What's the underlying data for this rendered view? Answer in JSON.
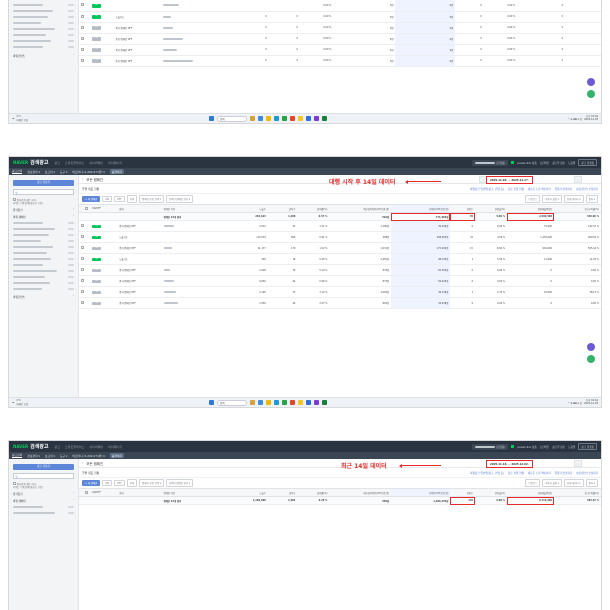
{
  "app": {
    "brand": "NAVER",
    "title": "검색광고",
    "menu": [
      "광고",
      "스마트플레이스",
      "네이버페이",
      "마이페이지"
    ],
    "account": "(운영중)",
    "status": "powerclick 상품",
    "right_items": [
      "조건버튼",
      "광고주 정보",
      "도움말"
    ],
    "right_button": "광고 플랫폼"
  },
  "subnav": {
    "items": [
      "광고관리",
      "정보관리 ▾",
      "보고서 ▾",
      "도구 ▾",
      "비즈머니 (1,202,271원) ▾"
    ],
    "tag": "충전하기"
  },
  "sidebar": {
    "create_button": "광고 만들기",
    "search_icon": "search-icon",
    "check_label": "일치검색 세트 하기,\n키워드 다중검색(쉼표로 구분)",
    "section_fav": "즐겨찾기",
    "section_campaign": "파워 캠페인",
    "footer_label": "파워콘텐츠"
  },
  "main": {
    "back_icon": "chevron-left-icon",
    "title": "모든 캠페인",
    "stats_label": "주별 개요 현황",
    "links": [
      "파워링크 일반탭(광고, 변형 등)",
      "검토 진행 현황",
      "새로운 노출 확인하기",
      "입찰가 변경하기",
      "쇼핑(전면) 수정하기"
    ],
    "toolbar": {
      "add": "+ 새 캠페인",
      "on": "ON",
      "off": "OFF",
      "del": "삭제",
      "select1": "캠페인 유형 선택 ▾",
      "select2": "선택된 캠페인 관리 ▾",
      "right": [
        "다운로드",
        "사용자 설정 ▾",
        "상세 데이터 ▾",
        "필터 ▾"
      ]
    },
    "columns": [
      "ON/OFF",
      "상태",
      "캠페인 이름",
      "노출수",
      "클릭수",
      "클릭률(%)",
      "평균클릭비용(VAT포함,원)",
      "총비용(VAT포함,원)",
      "전환수",
      "전환율(%)",
      "전환매출액(원)",
      "광고수익률(%)"
    ]
  },
  "screen1": {
    "rows": [
      {
        "toggle": "ON",
        "status": "",
        "s": [
          "",
          "",
          "0.00 %",
          "0원",
          "0원",
          "0",
          "0.00 %",
          "0"
        ]
      },
      {
        "toggle": "ON",
        "status": "노출가능",
        "s": [
          "0",
          "0",
          "0.00 %",
          "0원",
          "0원",
          "0",
          "0.00 %",
          "0"
        ]
      },
      {
        "toggle": "OFF",
        "status": "중지:캠페인 OFF",
        "s": [
          "0",
          "0",
          "0.00 %",
          "0원",
          "0원",
          "0",
          "0.00 %",
          "0"
        ]
      },
      {
        "toggle": "OFF",
        "status": "중지:캠페인 OFF",
        "s": [
          "0",
          "0",
          "0.00 %",
          "0원",
          "0원",
          "0",
          "0.00 %",
          "0"
        ]
      },
      {
        "toggle": "OFF",
        "status": "중지:캠페인 OFF",
        "s": [
          "0",
          "0",
          "0.00 %",
          "0원",
          "0원",
          "0",
          "0.00 %",
          "0"
        ]
      },
      {
        "toggle": "OFF",
        "status": "중지:캠페인 OFF",
        "s": [
          "0",
          "0",
          "0.00 %",
          "0원",
          "0원",
          "0",
          "0.00 %",
          "0"
        ]
      }
    ]
  },
  "screen2": {
    "annotation": "대행 시작 후 14일 데이터",
    "date_range": "2025.11.03. ~ 2025.11.17.",
    "total": {
      "name": "캠페인 23개 결과",
      "s": [
        "264,193",
        "1,498",
        "0.57 %",
        "516원",
        "771,583원",
        "76",
        "5.09 %",
        "2,599,508",
        "336.90 %"
      ]
    },
    "rows": [
      {
        "toggle": "ON",
        "status": "중지:캠페인 OFF",
        "s": [
          "2,512",
          "33",
          "1.31 %",
          "1,190원",
          "39,266원",
          "0",
          "0.00 %",
          "75,600",
          "192.53 %"
        ]
      },
      {
        "toggle": "ON",
        "status": "노출가능",
        "s": [
          "110,534",
          "899",
          "0.81 %",
          "298원",
          "268,003원",
          "41",
          "4.56 %",
          "1,235,000",
          "460.82 %"
        ]
      },
      {
        "toggle": "OFF",
        "status": "중지:캠페인 OFF",
        "s": [
          "11,177",
          "170",
          "1.52 %",
          "1,031원",
          "175,260원",
          "15",
          "8.82 %",
          "991,000",
          "565.44 %"
        ]
      },
      {
        "toggle": "ON",
        "status": "노출가능",
        "s": [
          "305",
          "18",
          "5.90 %",
          "5,455원",
          "98,195원",
          "1",
          "5.56 %",
          "11,000",
          "11.20 %"
        ]
      },
      {
        "toggle": "OFF",
        "status": "중지:캠페인 OFF",
        "s": [
          "1,528",
          "78",
          "5.10 %",
          "833원",
          "65,004원",
          "0",
          "0.00 %",
          "0",
          "0.00 %"
        ]
      },
      {
        "toggle": "OFF",
        "status": "중지:캠페인 OFF",
        "s": [
          "6,650",
          "64",
          "0.96 %",
          "875원",
          "56,023원",
          "0",
          "0.00 %",
          "0",
          "0.00 %"
        ]
      },
      {
        "toggle": "OFF",
        "status": "중지:캠페인 OFF",
        "s": [
          "1,195",
          "37",
          "3.10 %",
          "1,063원",
          "39,336원",
          "1",
          "2.70 %",
          "15,000",
          "38.13 %"
        ]
      },
      {
        "toggle": "OFF",
        "status": "중지:캠페인 OFF",
        "s": [
          "1,559",
          "40",
          "2.57 %",
          "865원",
          "34,618원",
          "0",
          "0.00 %",
          "0",
          "0.00 %"
        ]
      }
    ]
  },
  "screen3": {
    "annotation": "최근 14일 데이터",
    "date_range": "2025.11.18. ~ 2025.12.02.",
    "total": {
      "name": "캠페인 23개 결과",
      "s": [
        "1,186,998",
        "2,384",
        "0.20 %",
        "559원",
        "1,306,445원",
        "145",
        "6.08 %",
        "6,716,300",
        "393.42 %"
      ]
    }
  },
  "taskbar": {
    "weather": "4°C\n대체로 흐림",
    "search": "검색",
    "tray": "^  ⊕  ⌨  A  한",
    "clock_time_1": "오후 10:40",
    "clock_date_1": "2025-12-03",
    "clock_time_2": "오후 10:42",
    "clock_date_2": "2025-12-03"
  },
  "colors": {
    "accent_red": "#e52b2b",
    "naver_green": "#03c75a",
    "primary_blue": "#5e86d8",
    "topbar": "#2a3440"
  }
}
